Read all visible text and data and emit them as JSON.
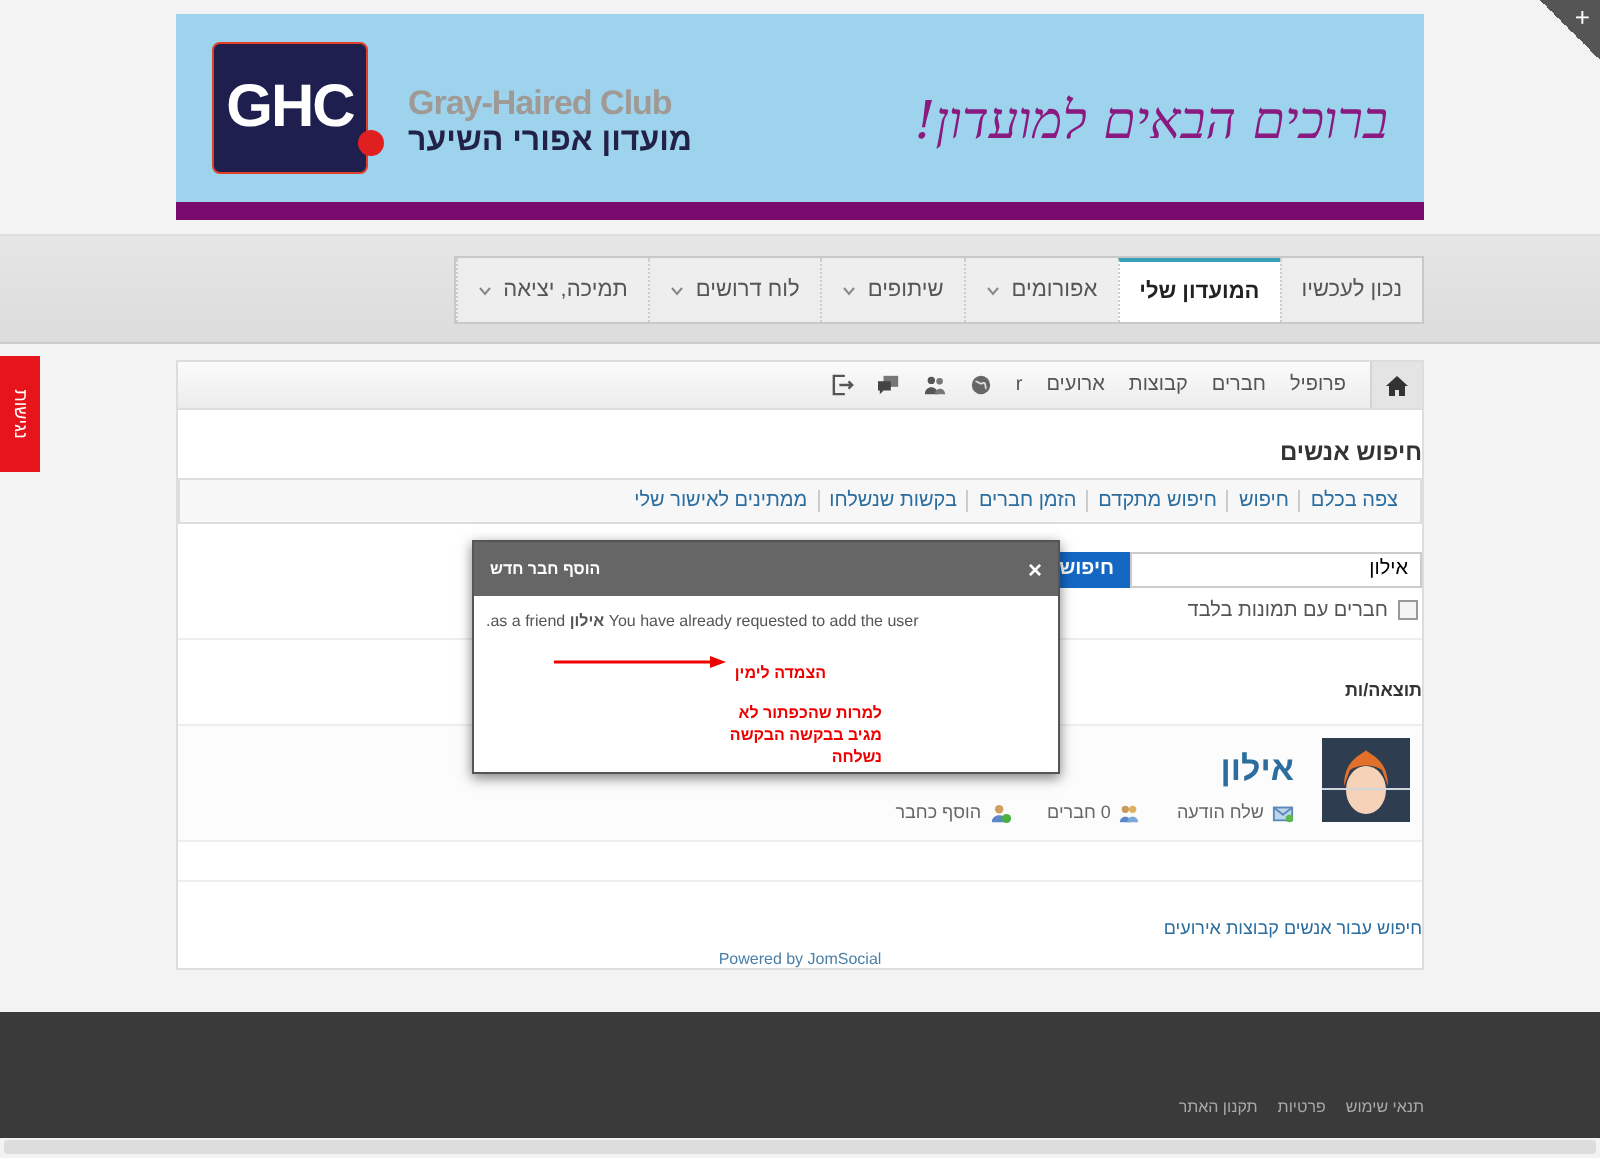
{
  "corner_button": {
    "label": "+"
  },
  "accessibility_tab": {
    "label": "נגישות"
  },
  "banner": {
    "logo_letters": "GHC",
    "club_name_en": "Gray-Haired Club",
    "club_name_he": "מועדון אפורי השיער",
    "slogan": "ברוכים הבאים למועדון!"
  },
  "main_menu": [
    {
      "label": "נכון לעכשיו",
      "selected": false,
      "has_menu": false
    },
    {
      "label": "המועדון שלי",
      "selected": true,
      "has_menu": false
    },
    {
      "label": "אפורומים",
      "selected": false,
      "has_menu": true
    },
    {
      "label": "שיתופים",
      "selected": false,
      "has_menu": true
    },
    {
      "label": "לוח דרושים",
      "selected": false,
      "has_menu": true
    },
    {
      "label": "תמיכה, יציאה",
      "selected": false,
      "has_menu": true
    }
  ],
  "toolbar": {
    "items": [
      "פרופיל",
      "חברים",
      "קבוצות",
      "ארועים",
      "r"
    ]
  },
  "page_title": "חיפוש אנשים",
  "sub_menu": [
    "צפה בכלם",
    "חיפוש",
    "חיפוש מתקדם",
    "הזמן חברים",
    "בקשות שנשלחו",
    "ממתינים לאישור שלי"
  ],
  "search": {
    "value": "אילון",
    "button": "חיפוש",
    "photo_only": {
      "label": "חברים עם תמונות בלבד",
      "checked": false
    }
  },
  "results_label": "תוצאה/ות",
  "results": [
    {
      "name": "אילון",
      "actions": [
        {
          "kind": "message",
          "label": "שלח הודעה"
        },
        {
          "kind": "friends",
          "label": "0 חברים"
        },
        {
          "kind": "add",
          "label": "הוסף כחבר"
        }
      ]
    }
  ],
  "search_for": "חיפוש עבור אנשים קבוצות אירועים",
  "powered_by": "Powered by JomSocial",
  "dialog": {
    "title": "הוסף חבר חדש",
    "close": "×",
    "message": "You have already requested to add the user **אילון** as a friend.",
    "annotation_title": "הצמדה לימין",
    "annotation_note": "למרות שהכפתור לא מגיב בבקשה הבקשה נשלחה"
  },
  "footer_links": [
    "תנאי שימוש",
    "פרטיות",
    "תקנון האתר"
  ]
}
